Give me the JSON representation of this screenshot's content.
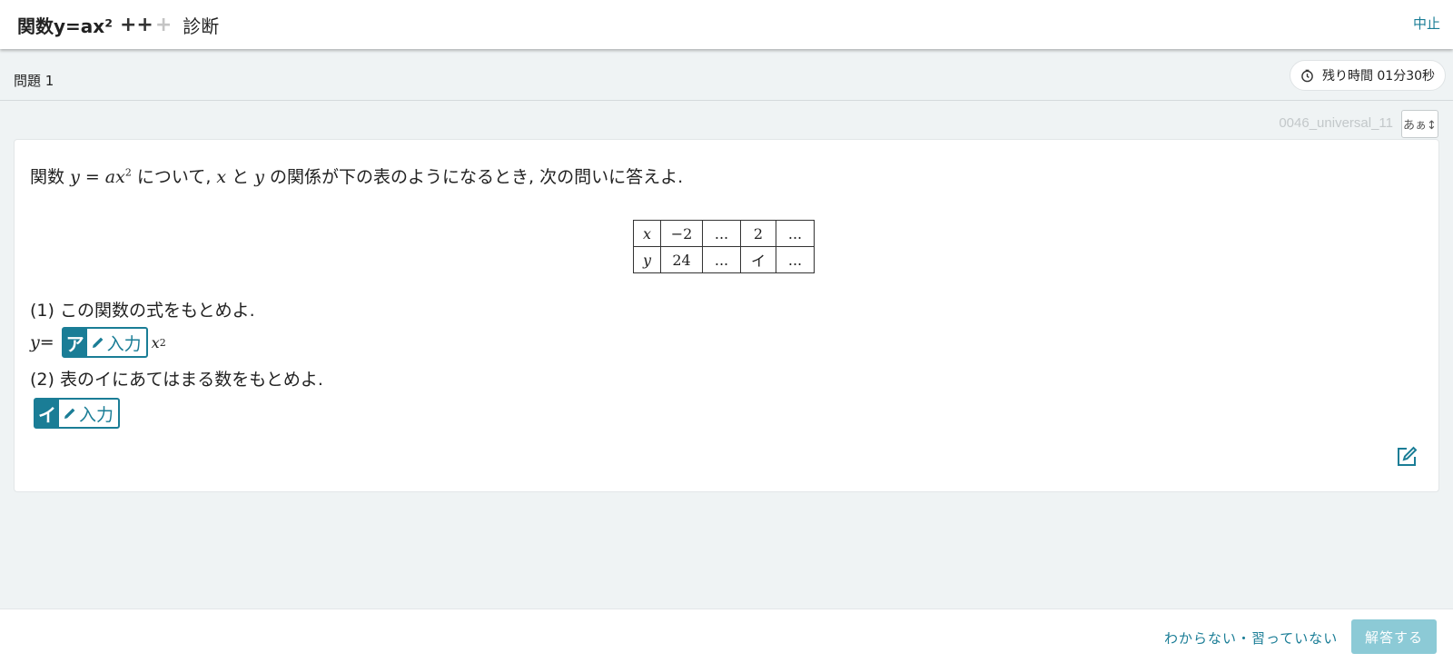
{
  "header": {
    "function_label": "関数y=ax²",
    "level_on": "++",
    "level_off": "+",
    "mode": "診断",
    "stop_label": "中止"
  },
  "question_bar": {
    "label": "問題 1",
    "timer_text": "残り時間 01分30秒"
  },
  "question_id": "0046_universal_11",
  "font_size_button": "あぁ↕",
  "problem": {
    "intro_lead": "関数",
    "intro_y": "y",
    "intro_eq": " = ",
    "intro_a": "a",
    "intro_x": "x",
    "intro_exp": "2",
    "intro_mid1": " について, ",
    "intro_xvar": "x",
    "intro_to": " と ",
    "intro_yvar": "y",
    "intro_tail": " の関係が下の表のようになるとき, 次の問いに答えよ.",
    "table": {
      "row_x": [
        "x",
        "−2",
        "...",
        "2",
        "..."
      ],
      "row_y": [
        "y",
        "24",
        "...",
        "イ",
        "..."
      ]
    },
    "sub1": "(1) この関数の式をもとめよ.",
    "sub1_lhs_y": "y",
    "sub1_lhs_eq": " = ",
    "sub1_rhs_x": "x",
    "sub1_rhs_exp": "2",
    "sub2": "(2) 表のイにあてはまる数をもとめよ.",
    "answers": [
      {
        "key": "ア",
        "input_label": "入力"
      },
      {
        "key": "イ",
        "input_label": "入力"
      }
    ]
  },
  "footer": {
    "dont_know": "わからない・習っていない",
    "submit": "解答する"
  },
  "colors": {
    "accent": "#1a7d96",
    "submit_disabled": "#8ccad6",
    "background": "#eff3f4"
  },
  "icons": [
    "timer-icon",
    "pencil-icon",
    "edit-note-icon",
    "font-size-icon"
  ]
}
